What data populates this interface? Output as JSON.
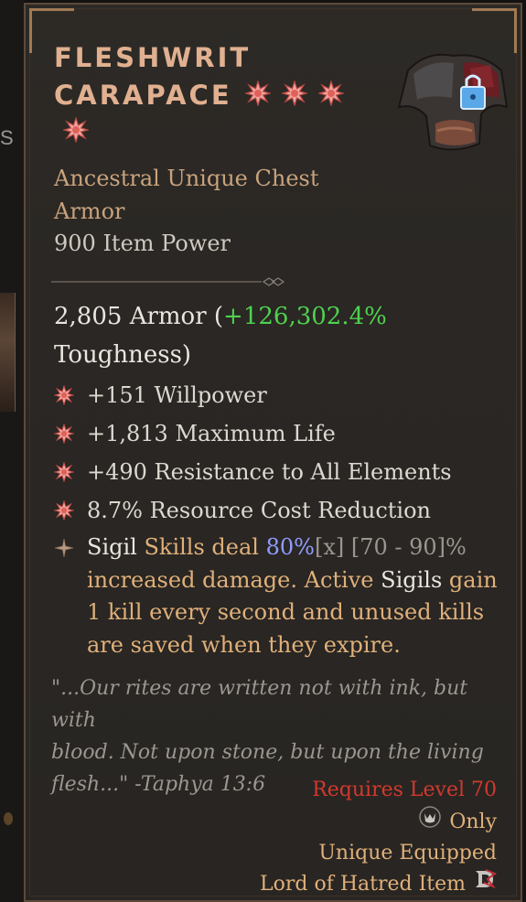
{
  "item": {
    "name_line1": "FLESHWRIT",
    "name_line2": "CARAPACE",
    "rarity_line1": "Ancestral Unique Chest",
    "rarity_line2": "Armor",
    "item_power": "900 Item Power"
  },
  "armor": {
    "value_text": "2,805 Armor (",
    "bonus": "+126,302.4%",
    "suffix": "Toughness)"
  },
  "affixes": [
    "+151 Willpower",
    "+1,813 Maximum Life",
    "+490 Resistance to All Elements",
    "8.7% Resource Cost Reduction"
  ],
  "legendary": {
    "p1": "Sigil",
    "p2": " Skills deal ",
    "value": "80%",
    "bracket_x": "[x]",
    "range": " [70 - 90]%",
    "p3": "increased damage. Active",
    "p4": " Sigils",
    "p5": " gain",
    "p6": "1 kill every second and unused kills",
    "p7": "are saved when they expire."
  },
  "flavor": {
    "line1": "\"...Our rites are written not with ink, but with",
    "line2": "blood. Not upon stone, but upon the living",
    "line3": "flesh...\" -Taphya 13:6"
  },
  "requirements": {
    "level": "Requires Level 70",
    "class_only": "Only",
    "unique_equipped": "Unique Equipped",
    "expansion": "Lord of Hatred Item"
  },
  "left_edge": {
    "letter": "S"
  },
  "colors": {
    "title": "#e0b090",
    "green_bonus": "#4fd14f",
    "requirement_red": "#d03a2e",
    "unique_orange": "#e0b07a",
    "value_blue": "#8f9bff"
  }
}
